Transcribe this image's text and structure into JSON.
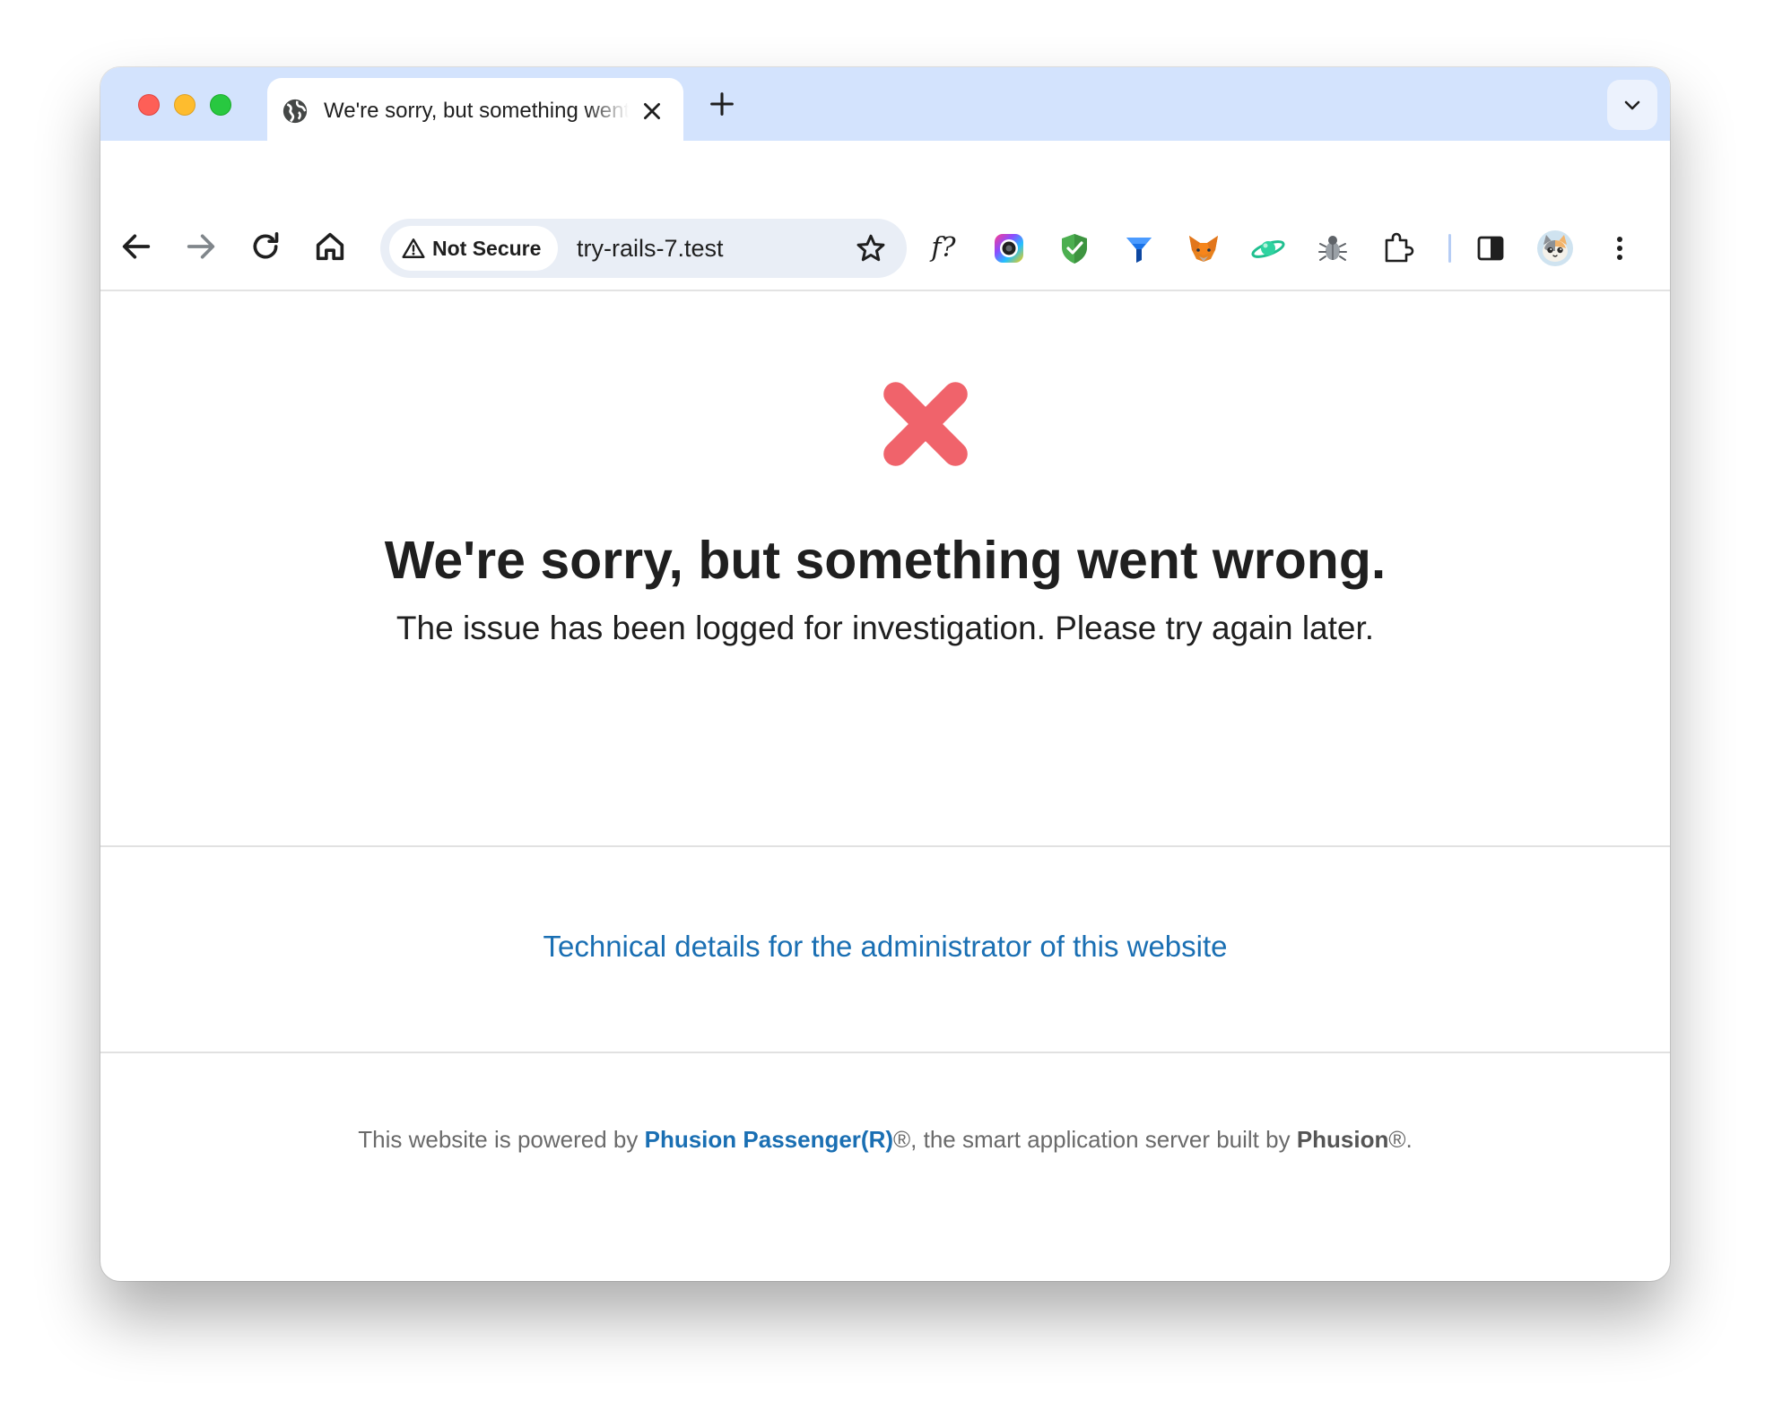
{
  "browser": {
    "tab": {
      "title": "We're sorry, but something went wrong"
    },
    "omnibox": {
      "security_label": "Not Secure",
      "url": "try-rails-7.test"
    },
    "toolbar_icons": [
      "back-icon",
      "forward-icon",
      "reload-icon",
      "home-icon",
      "bookmark-star-icon",
      "extensions-puzzle-icon",
      "side-panel-icon",
      "kebab-menu-icon"
    ],
    "extensions": [
      {
        "name": "font-finder",
        "label": "f?"
      },
      {
        "name": "color-picker"
      },
      {
        "name": "shield-checkmark"
      },
      {
        "name": "blue-funnel"
      },
      {
        "name": "metamask-fox"
      },
      {
        "name": "green-planet"
      },
      {
        "name": "bug-debugger"
      }
    ]
  },
  "page": {
    "heading": "We're sorry, but something went wrong.",
    "subtext": "The issue has been logged for investigation. Please try again later.",
    "tech_link": "Technical details for the administrator of this website",
    "footer": {
      "prefix": "This website is powered by ",
      "product": "Phusion Passenger(R)",
      "middle": "®, the smart application server built by ",
      "company": "Phusion",
      "suffix": "®."
    }
  },
  "colors": {
    "tabstrip": "#d3e3fd",
    "error_x": "#f0636b",
    "link": "#1a6fb3",
    "omnibox": "#e9eef6"
  }
}
